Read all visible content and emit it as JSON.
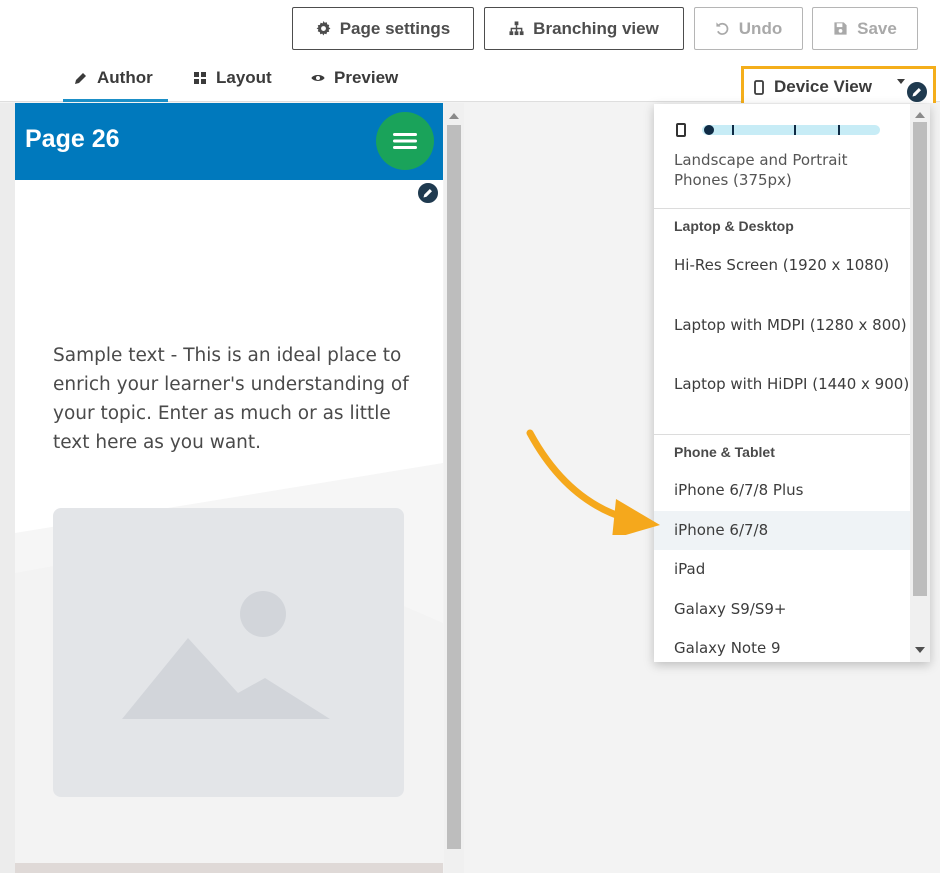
{
  "toolbar": {
    "page_settings": "Page settings",
    "branching_view": "Branching view",
    "undo": "Undo",
    "save": "Save"
  },
  "tabs": [
    {
      "label": "Author",
      "active": true
    },
    {
      "label": "Layout",
      "active": false
    },
    {
      "label": "Preview",
      "active": false
    }
  ],
  "device_view": {
    "label": "Device View"
  },
  "page": {
    "title": "Page 26",
    "sample_text": "Sample text - This is an ideal place to enrich your learner's understanding of your topic. Enter as much or as little text here as you want."
  },
  "dropdown": {
    "current": "Landscape and Portrait Phones (375px)",
    "groups": [
      {
        "label": "Laptop & Desktop",
        "items": [
          "Hi-Res Screen (1920 x 1080)",
          "Laptop with MDPI (1280 x 800)",
          "Laptop with HiDPI (1440 x 900)"
        ]
      },
      {
        "label": "Phone & Tablet",
        "items": [
          "iPhone 6/7/8 Plus",
          "iPhone 6/7/8",
          "iPad",
          "Galaxy S9/S9+",
          "Galaxy Note 9"
        ]
      }
    ],
    "hovered_item": "iPhone 6/7/8"
  },
  "colors": {
    "header_blue": "#0079bd",
    "menu_green": "#1aa35a",
    "highlight_orange": "#f4ae1b",
    "arrow_orange": "#f5a81c",
    "active_tab_underline": "#1b8fc7"
  },
  "icons": {
    "page_settings": "gear-icon",
    "branching_view": "sitemap-icon",
    "undo": "undo-icon",
    "save": "floppy-icon",
    "author": "pencil-icon",
    "layout": "grid-icon",
    "preview": "eye-icon",
    "device_view": "phone-icon",
    "menu": "hamburger-icon"
  }
}
